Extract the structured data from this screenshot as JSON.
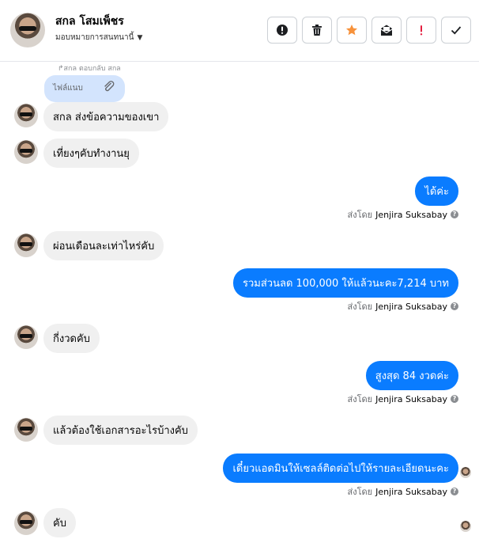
{
  "header": {
    "name": "สกล โสมเพ็ชร",
    "assign_label": "มอบหมายการสนทนานี้",
    "actions": [
      {
        "name": "report-button",
        "icon": "exclamation-circle-icon",
        "color": "#1c1e21"
      },
      {
        "name": "delete-button",
        "icon": "trash-icon",
        "color": "#1c1e21"
      },
      {
        "name": "star-button",
        "icon": "star-icon",
        "color": "#f7923b"
      },
      {
        "name": "mark-unread-button",
        "icon": "envelope-open-icon",
        "color": "#1c1e21"
      },
      {
        "name": "important-button",
        "icon": "exclamation-icon",
        "color": "#e41e3f"
      },
      {
        "name": "done-button",
        "icon": "checkmark-icon",
        "color": "#1c1e21"
      }
    ]
  },
  "feed": {
    "reply_label": "↱สกล ตอบกลับ สกล",
    "reply_attachment": "ไฟล์แนบ",
    "messages": [
      {
        "dir": "in",
        "text": "สกล ส่งข้อความของเขา"
      },
      {
        "dir": "in",
        "text": "เที่ยงๆคับทำงานยุ"
      },
      {
        "dir": "out",
        "text": "ได้ค่ะ",
        "sent_prefix": "ส่งโดย",
        "sender": "Jenjira Suksabay"
      },
      {
        "dir": "in",
        "text": "ผ่อนเดือนละเท่าไหร่คับ"
      },
      {
        "dir": "out",
        "text": "รวมส่วนลด 100,000 ให้แล้วนะคะ7,214 บาท",
        "sent_prefix": "ส่งโดย",
        "sender": "Jenjira Suksabay"
      },
      {
        "dir": "in",
        "text": "กี่งวดคับ"
      },
      {
        "dir": "out",
        "text": "สูงสุด 84 งวดค่ะ",
        "sent_prefix": "ส่งโดย",
        "sender": "Jenjira Suksabay"
      },
      {
        "dir": "in",
        "text": "แล้วต้องใช้เอกสารอะไรบ้างคับ"
      },
      {
        "dir": "out",
        "text": "เดี๋ยวแอดมินให้เซลล์ติดต่อไปให้รายละเอียดนะคะ",
        "sent_prefix": "ส่งโดย",
        "sender": "Jenjira Suksabay"
      },
      {
        "dir": "in",
        "text": "คับ"
      }
    ]
  },
  "colors": {
    "outgoing_bubble": "#0a7cff",
    "incoming_bubble": "#f0f0f0",
    "reply_bubble": "#d3e4fd"
  }
}
